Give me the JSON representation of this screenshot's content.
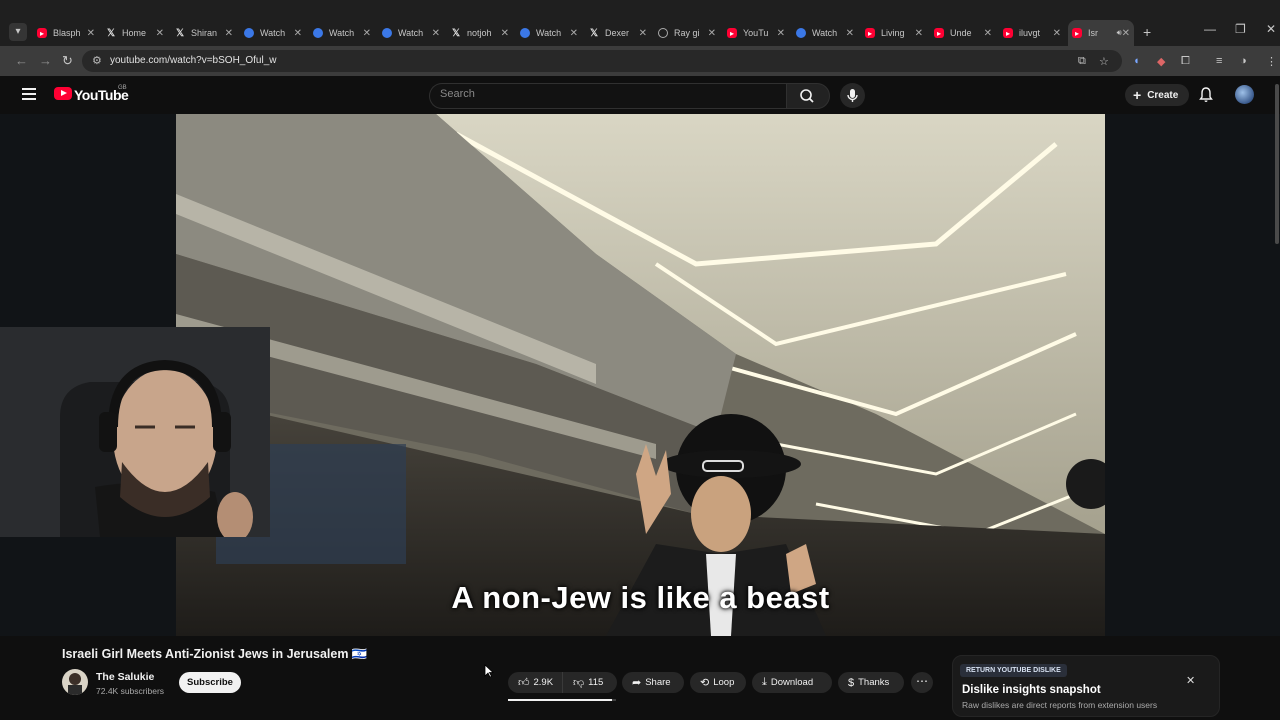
{
  "browser": {
    "tabs": [
      {
        "title": "Blasph",
        "favicon": "youtube-icon",
        "active": false
      },
      {
        "title": "Home",
        "favicon": "x-logo-icon",
        "active": false
      },
      {
        "title": "Shiran",
        "favicon": "x-logo-icon",
        "active": false
      },
      {
        "title": "Watch",
        "favicon": "web-icon",
        "active": false
      },
      {
        "title": "Watch",
        "favicon": "web-icon",
        "active": false
      },
      {
        "title": "Watch",
        "favicon": "web-icon",
        "active": false
      },
      {
        "title": "notjoh",
        "favicon": "x-logo-icon",
        "active": false
      },
      {
        "title": "Watch",
        "favicon": "web-icon",
        "active": false
      },
      {
        "title": "Dexer",
        "favicon": "x-logo-icon",
        "active": false
      },
      {
        "title": "Ray gi",
        "favicon": "generic-icon",
        "active": false
      },
      {
        "title": "YouTu",
        "favicon": "youtube-icon",
        "active": false
      },
      {
        "title": "Watch",
        "favicon": "web-icon",
        "active": false
      },
      {
        "title": "Living",
        "favicon": "youtube-icon",
        "active": false
      },
      {
        "title": "Unde",
        "favicon": "youtube-icon",
        "active": false
      },
      {
        "title": "iluvgt",
        "favicon": "youtube-icon",
        "active": false
      },
      {
        "title": "Isr",
        "favicon": "youtube-icon",
        "active": true
      }
    ],
    "url": "youtube.com/watch?v=bSOH_Oful_w",
    "accent_color": "#1f1f1f"
  },
  "youtube": {
    "logo_text": "YouTube",
    "region": "GB",
    "search_placeholder": "Search",
    "create_label": "Create",
    "brand_color": "#ff0033"
  },
  "video": {
    "subtitle": "A non-Jew is like a beast",
    "title": "Israeli Girl Meets Anti-Zionist Jews in Jerusalem ‮🇮🇱",
    "channel": {
      "name": "The Salukie",
      "subscribers": "72.4K subscribers",
      "subscribe_label": "Subscribe"
    },
    "actions": {
      "likes": "2.9K",
      "dislikes": "115",
      "share": "Share",
      "loop": "Loop",
      "download": "Download",
      "thanks": "Thanks",
      "like_ratio": 0.96
    }
  },
  "ryd_panel": {
    "badge": "RETURN YOUTUBE DISLIKE",
    "title": "Dislike insights snapshot",
    "description": "Raw dislikes are direct reports from extension users"
  }
}
